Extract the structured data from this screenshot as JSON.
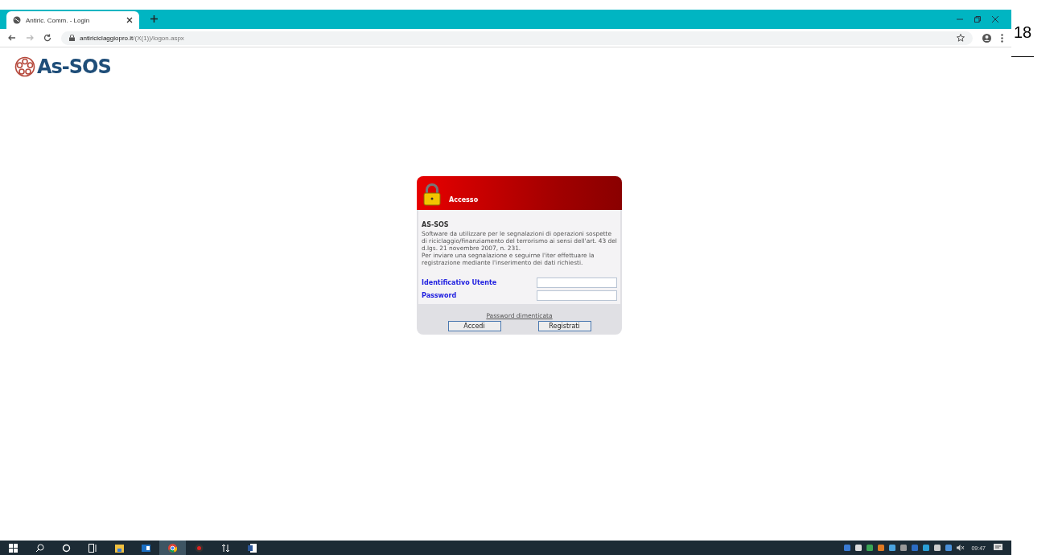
{
  "browser": {
    "tab": {
      "title": "Antiric. Comm. - Login",
      "selected": true
    },
    "url": {
      "domain": "antiriciclaggiopro.it",
      "path": "/(X(1))/logon.aspx"
    }
  },
  "logo": {
    "text": "As-SOS"
  },
  "dialog": {
    "title": "Accesso",
    "heading": "AS-SOS",
    "paragraphs": [
      "Software da utilizzare per le segnalazioni di operazioni sospette di riciclaggio/finanziamento del terrorismo ai sensi dell'art. 43 del d.lgs. 21 novembre 2007, n. 231.",
      "Per inviare una segnalazione e seguirne l'iter effettuare la registrazione mediante l'inserimento dei dati richiesti."
    ],
    "fields": [
      {
        "label": "Identificativo Utente"
      },
      {
        "label": "Password"
      }
    ],
    "link": "Password dimenticata",
    "buttons": [
      "Accedi",
      "Registrati"
    ]
  },
  "taskbar": {
    "clock": "09:47"
  },
  "page_number": "18"
}
